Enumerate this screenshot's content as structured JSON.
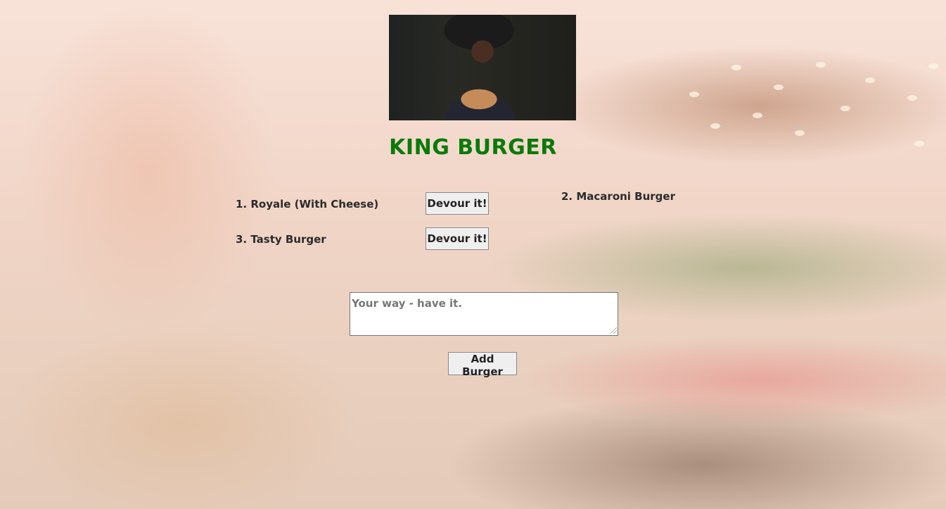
{
  "header": {
    "title": "KING BURGER"
  },
  "burgers": {
    "not_devoured": [
      {
        "label": "1. Royale (With Cheese)",
        "button": "Devour it!"
      },
      {
        "label": "3. Tasty Burger",
        "button": "Devour it!"
      }
    ],
    "devoured": [
      {
        "label": "2. Macaroni Burger"
      }
    ]
  },
  "form": {
    "placeholder": "Your way - have it.",
    "value": "",
    "submit_label": "Add Burger"
  },
  "colors": {
    "title": "#0a7a0a"
  },
  "icons": {
    "textarea_resize": "resize-grip-icon"
  }
}
